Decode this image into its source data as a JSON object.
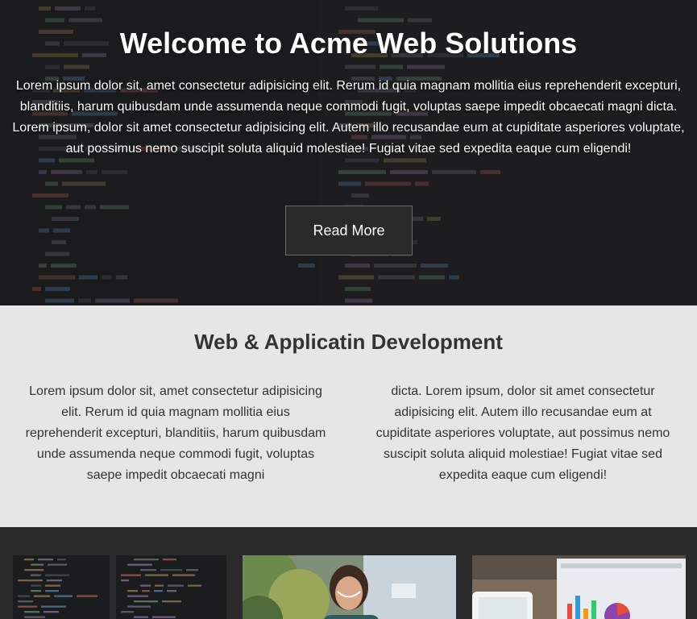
{
  "hero": {
    "title": "Welcome to Acme Web Solutions",
    "text": "Lorem ipsum dolor sit, amet consectetur adipisicing elit. Rerum id quia magnam mollitia eius reprehenderit excepturi, blanditiis, harum quibusdam unde assumenda neque commodi fugit, voluptas saepe impedit obcaecati magni dicta. Lorem ipsum, dolor sit amet consectetur adipisicing elit. Autem illo recusandae eum at cupiditate asperiores voluptate, aut possimus nemo suscipit soluta aliquid molestiae! Fugiat vitae sed expedita eaque cum eligendi!",
    "button_label": "Read More"
  },
  "development": {
    "title": "Web & Applicatin Development",
    "column_left": "Lorem ipsum dolor sit, amet consectetur adipisicing elit. Rerum id quia magnam mollitia eius reprehenderit excepturi, blanditiis, harum quibusdam unde assumenda neque commodi fugit, voluptas saepe impedit obcaecati magni",
    "column_right": "dicta. Lorem ipsum, dolor sit amet consectetur adipisicing elit. Autem illo recusandae eum at cupiditate asperiores voluptate, aut possimus nemo suscipit soluta aliquid molestiae! Fugiat vitae sed expedita eaque cum eligendi!"
  },
  "colors": {
    "hero_bg": "#1e1f21",
    "section_bg": "#e6e6e6",
    "footer_bg": "#2b2b2b",
    "text_dark": "#333333"
  },
  "gallery": {
    "images": [
      "code-screen-image",
      "smiling-woman-image",
      "tablet-charts-image"
    ]
  }
}
